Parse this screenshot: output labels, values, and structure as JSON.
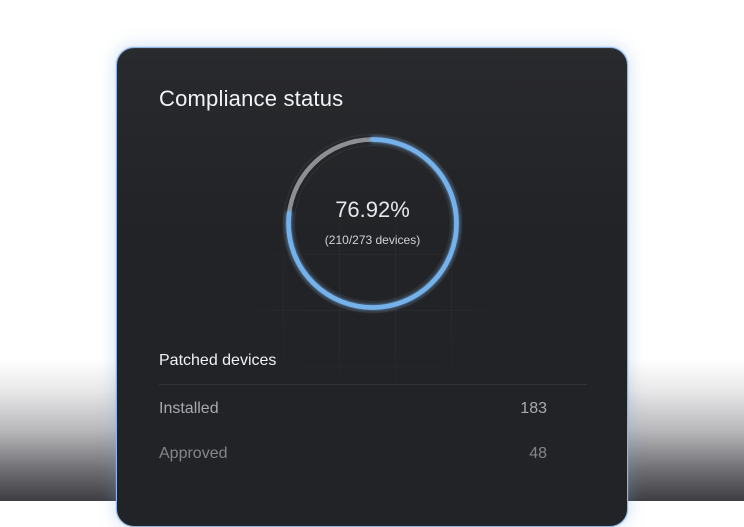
{
  "card": {
    "title": "Compliance status"
  },
  "gauge": {
    "value_text": "76.92%",
    "sub_text": "(210/273 devices)",
    "progress": 0.7692,
    "colors": {
      "progress": "#74b2ec",
      "track": "#8d8f94"
    }
  },
  "patched": {
    "title": "Patched devices",
    "rows": [
      {
        "label": "Installed",
        "value": "183"
      },
      {
        "label": "Approved",
        "value": "48"
      }
    ]
  }
}
